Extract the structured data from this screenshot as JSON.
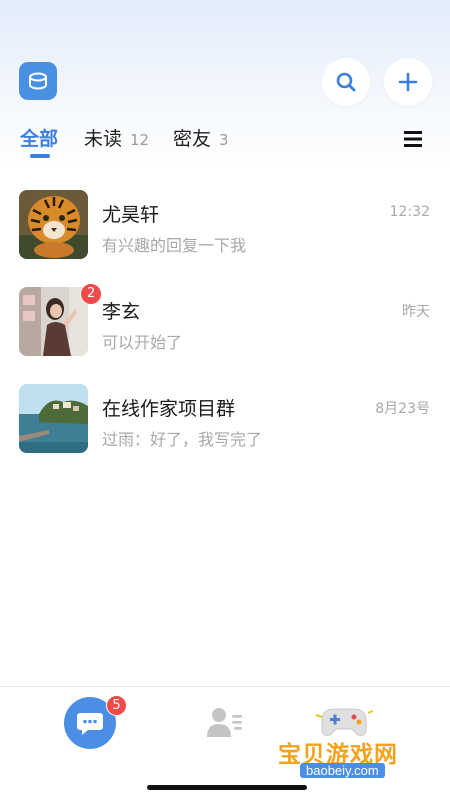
{
  "header": {
    "logo_icon": "app-logo-icon",
    "search_icon": "search-icon",
    "add_icon": "plus-icon"
  },
  "tabs": [
    {
      "label": "全部",
      "count": "",
      "active": true
    },
    {
      "label": "未读",
      "count": "12",
      "active": false
    },
    {
      "label": "密友",
      "count": "3",
      "active": false
    }
  ],
  "chats": [
    {
      "name": "尤昊轩",
      "preview": "有兴趣的回复一下我",
      "time": "12:32",
      "badge": "",
      "avatar": "tiger-photo"
    },
    {
      "name": "李玄",
      "preview": "可以开始了",
      "time": "昨天",
      "badge": "2",
      "avatar": "girl-photo"
    },
    {
      "name": "在线作家项目群",
      "preview": "过雨：好了，我写完了",
      "time": "8月23号",
      "badge": "",
      "avatar": "coast-photo"
    }
  ],
  "bottom_nav": {
    "messages_badge": "5",
    "watermark_text": "宝贝游戏网",
    "watermark_url": "baobeiy.com"
  },
  "colors": {
    "accent": "#3d7fe0",
    "badge": "#f04a4a"
  }
}
